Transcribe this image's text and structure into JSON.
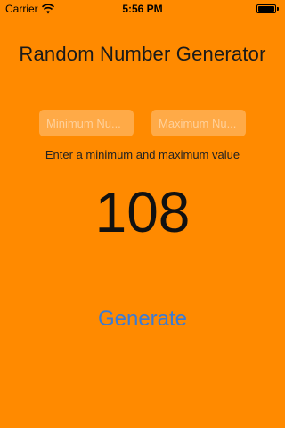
{
  "status_bar": {
    "carrier": "Carrier",
    "time": "5:56 PM",
    "wifi_icon": "wifi-icon",
    "battery_icon": "battery-icon",
    "battery_level": 1.0
  },
  "title": "Random Number Generator",
  "inputs": {
    "minimum": {
      "placeholder": "Minimum Nu...",
      "value": ""
    },
    "maximum": {
      "placeholder": "Maximum Nu...",
      "value": ""
    }
  },
  "instruction": "Enter a minimum and maximum value",
  "result": "108",
  "generate_label": "Generate",
  "colors": {
    "background": "#ff8a00",
    "button_text": "#3a7bd5"
  }
}
